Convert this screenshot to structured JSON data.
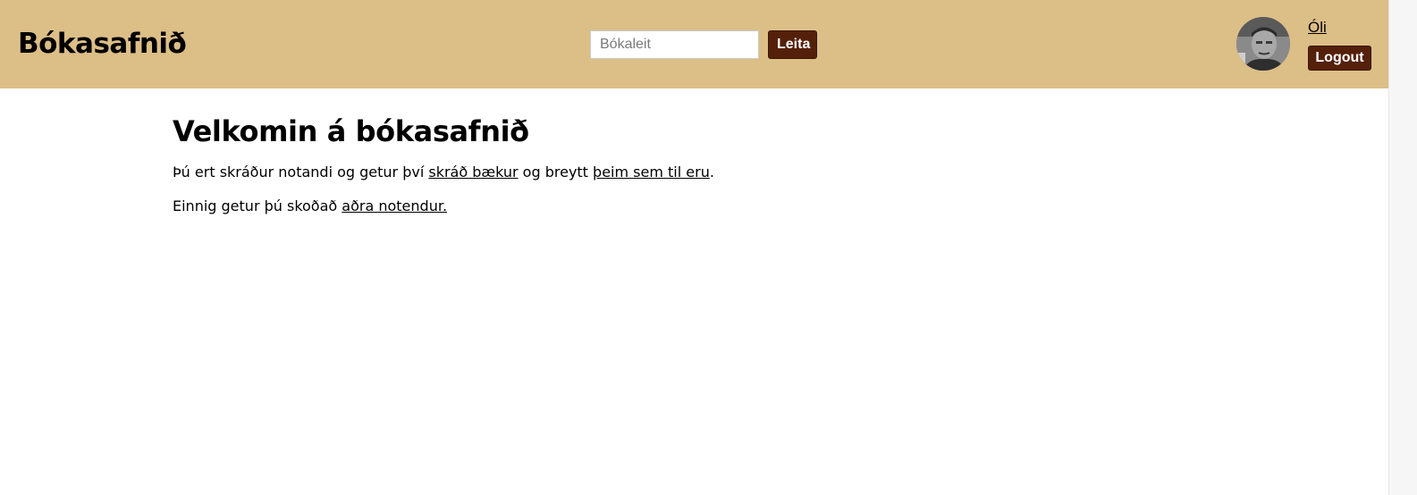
{
  "header": {
    "brand": "Bókasafnið",
    "search": {
      "placeholder": "Bókaleit",
      "value": "",
      "button_label": "Leita"
    },
    "user": {
      "name": "Óli",
      "logout_label": "Logout"
    }
  },
  "main": {
    "title": "Velkomin á bókasafnið",
    "paragraph1": {
      "text_before": "Þú ert skráður notandi og getur því ",
      "link1": "skráð bækur",
      "text_middle": " og breytt ",
      "link2": "þeim sem til eru",
      "text_after": "."
    },
    "paragraph2": {
      "text_before": "Einnig getur þú skoðað ",
      "link": "aðra notendur."
    }
  },
  "colors": {
    "header_bg": "#dcbe87",
    "button_bg": "#54200a",
    "button_text": "#ffffff"
  }
}
